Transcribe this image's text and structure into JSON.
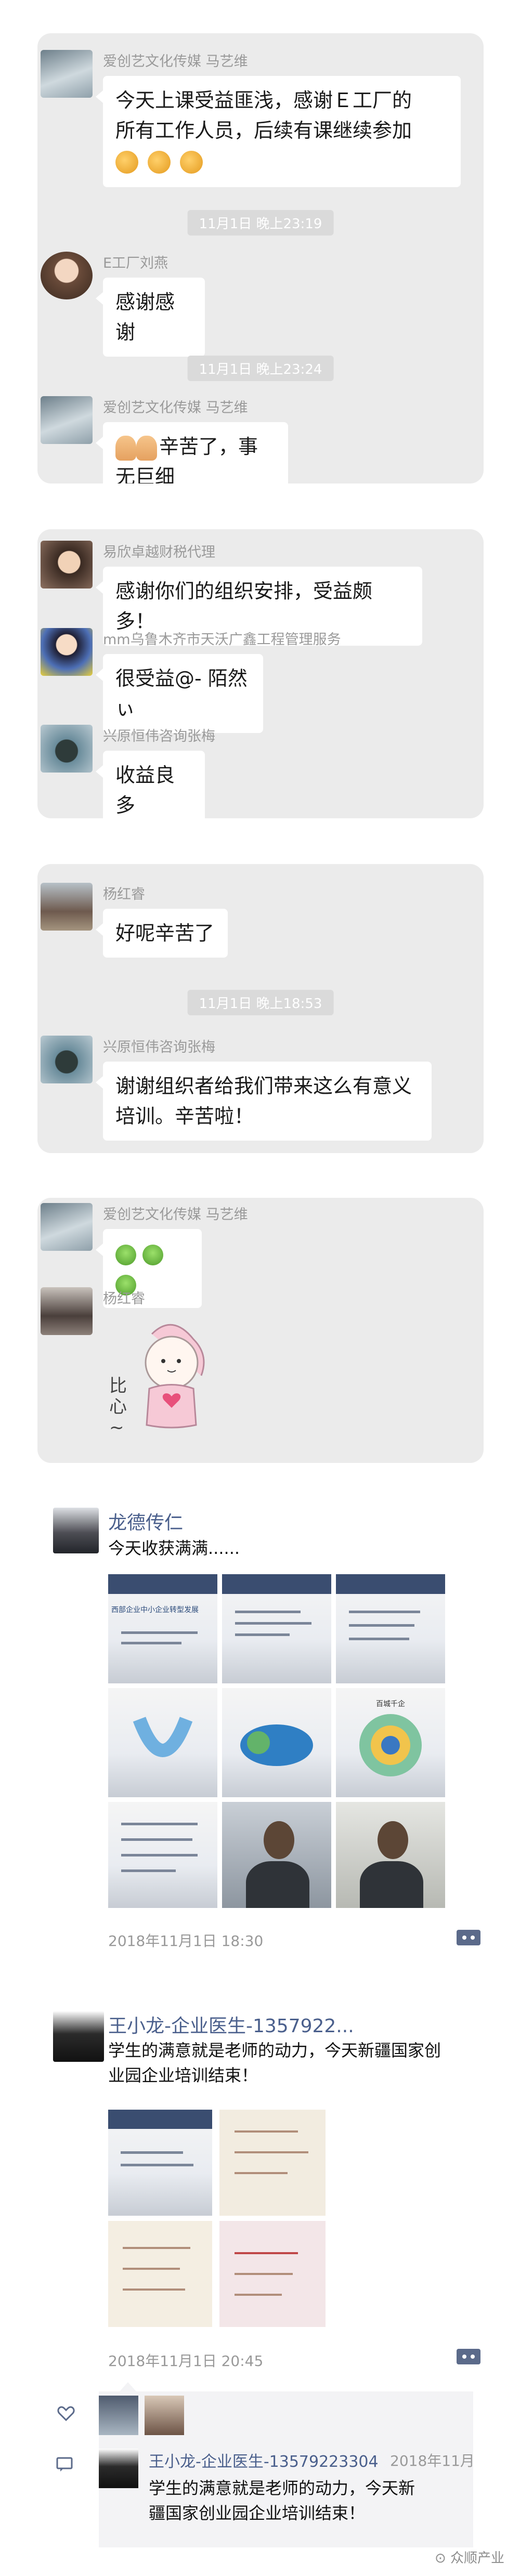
{
  "card1": {
    "messages": [
      {
        "sender": "爱创艺文化传媒  马艺维",
        "text": "今天上课受益匪浅，感谢Ｅ工厂的\n所有工作人员，后续有课继续参加"
      },
      {
        "sender": "E工厂刘燕",
        "text": "感谢感谢"
      },
      {
        "sender": "爱创艺文化传媒  马艺维",
        "text": "辛苦了，事无巨细"
      }
    ],
    "times": [
      "11月1日 晚上23:19",
      "11月1日 晚上23:24"
    ]
  },
  "card2": {
    "messages": [
      {
        "sender": "易欣卓越财税代理",
        "text": "感谢你们的组织安排，受益颇多！"
      },
      {
        "sender": "mm乌鲁木齐市天沃广鑫工程管理服务",
        "text": "很受益@- 陌然ぃ"
      },
      {
        "sender": "兴原恒伟咨询张梅",
        "text": "收益良多"
      }
    ]
  },
  "card3": {
    "messages": [
      {
        "sender": "杨红睿",
        "text": "好呢辛苦了"
      },
      {
        "sender": "兴原恒伟咨询张梅",
        "text": "谢谢组织者给我们带来这么有意义\n培训。辛苦啦！"
      }
    ],
    "times": [
      "11月1日 晚上18:53"
    ]
  },
  "card4": {
    "messages": [
      {
        "sender": "爱创艺文化传媒  马艺维"
      },
      {
        "sender": "杨红睿",
        "sticker_text": "比心~"
      }
    ]
  },
  "moment1": {
    "name": "龙德传仁",
    "text": "今天收获满满......",
    "time": "2018年11月1日 18:30",
    "slide_title": "西部企业中小企业转型发展",
    "slide_center": "百城千企"
  },
  "moment2": {
    "name": "王小龙-企业医生-1357922...",
    "text": "学生的满意就是老师的动力，今天新疆国家创\n业园企业培训结束！",
    "time": "2018年11月1日 20:45"
  },
  "comment": {
    "name": "王小龙-企业医生-13579223304",
    "date": "2018年11月",
    "text": "学生的满意就是老师的动力，今天新\n疆国家创业园企业培训结束！"
  },
  "watermark": "⊙ 众顺产业",
  "colors": {
    "card_bg": "#ebebeb",
    "link_blue": "#4a5f8c",
    "pill_bg": "#dadada"
  },
  "icons": [
    "like-heart-icon",
    "comment-icon",
    "more-actions-icon"
  ]
}
